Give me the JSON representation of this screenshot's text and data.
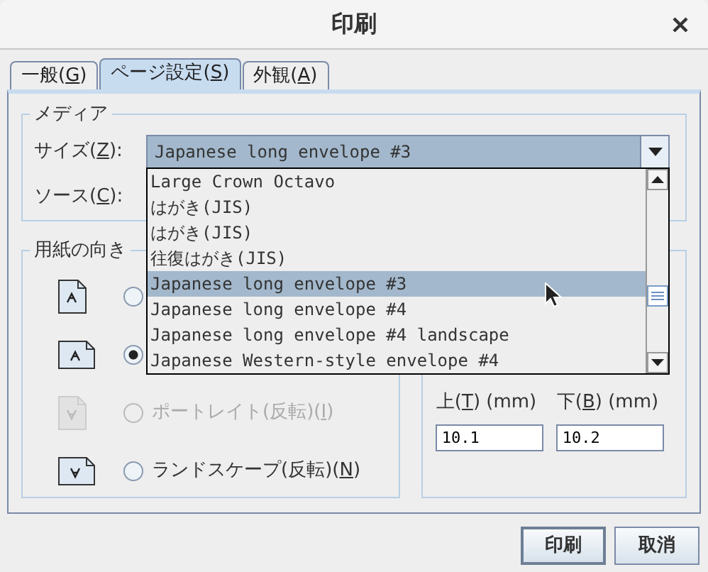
{
  "window": {
    "title": "印刷"
  },
  "tabs": [
    {
      "label": {
        "before": "一般(",
        "key": "G",
        "after": ")"
      },
      "selected": false
    },
    {
      "label": {
        "before": "ページ設定(",
        "key": "S",
        "after": ")"
      },
      "selected": true
    },
    {
      "label": {
        "before": "外観(",
        "key": "A",
        "after": ")"
      },
      "selected": false
    }
  ],
  "media": {
    "title": "メディア",
    "size_label": {
      "before": "サイズ(",
      "key": "Z",
      "after": "):"
    },
    "size_value": "Japanese long envelope #3",
    "source_label": {
      "before": "ソース(",
      "key": "C",
      "after": "):"
    }
  },
  "size_dropdown": {
    "options": [
      {
        "label": "Large Crown Octavo",
        "selected": false
      },
      {
        "label": "はがき(JIS)",
        "selected": false
      },
      {
        "label": "はがき(JIS)",
        "selected": false
      },
      {
        "label": "往復はがき(JIS)",
        "selected": false
      },
      {
        "label": "Japanese long envelope #3",
        "selected": true
      },
      {
        "label": "Japanese long envelope #4",
        "selected": false
      },
      {
        "label": "Japanese long envelope #4 landscape",
        "selected": false
      },
      {
        "label": "Japanese Western-style envelope #4",
        "selected": false
      }
    ]
  },
  "orientation": {
    "title": "用紙の向き",
    "options": [
      {
        "kind": "portrait",
        "selected": false,
        "disabled": false
      },
      {
        "kind": "landscape",
        "selected": true,
        "disabled": false
      },
      {
        "kind": "portrait-reversed",
        "selected": false,
        "disabled": true,
        "label": {
          "before": "ポートレイト(反転)(",
          "key": "I",
          "after": ")"
        }
      },
      {
        "kind": "landscape-reversed",
        "selected": false,
        "disabled": false,
        "label": {
          "before": "ランドスケープ(反転)(",
          "key": "N",
          "after": ")"
        }
      }
    ]
  },
  "margins": {
    "fields": [
      {
        "label": {
          "before": "上(",
          "key": "T",
          "after": ") (mm)"
        },
        "value": "10.1"
      },
      {
        "label": {
          "before": "下(",
          "key": "B",
          "after": ") (mm)"
        },
        "value": "10.2"
      }
    ]
  },
  "buttons": [
    {
      "label": "印刷",
      "default": true
    },
    {
      "label": "取消",
      "default": false
    }
  ]
}
